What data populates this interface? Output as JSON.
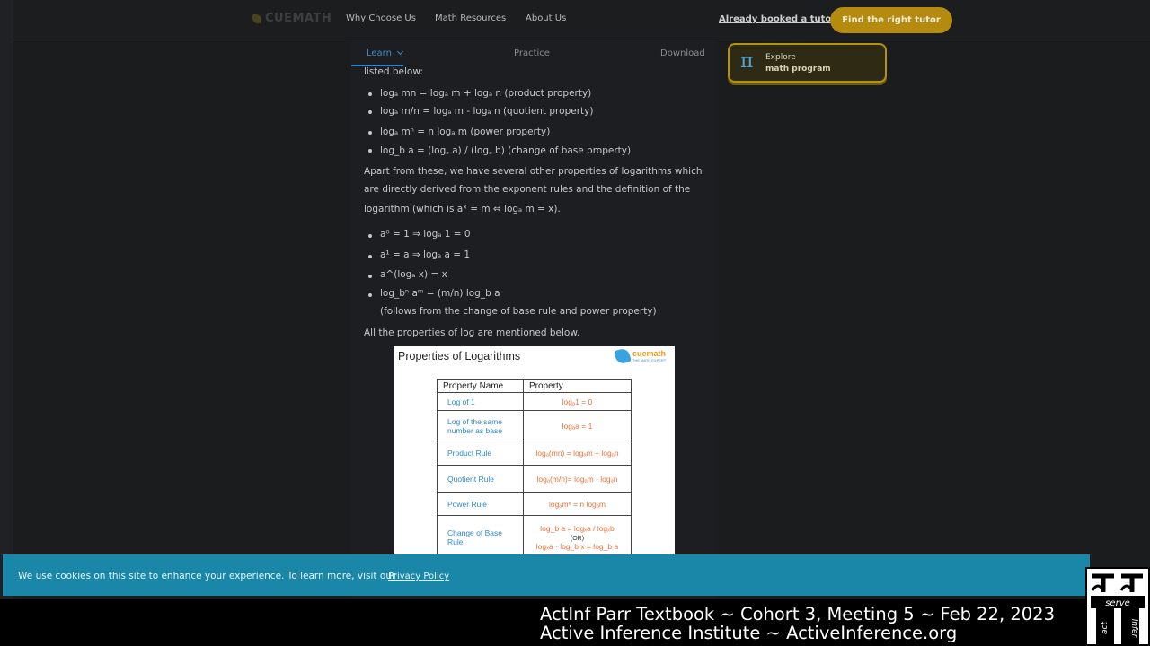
{
  "nav": {
    "logo": "CUEMATH",
    "links": [
      "Why Choose Us",
      "Math Resources",
      "About Us"
    ],
    "already_booked": "Already booked a tutor?",
    "find_tutor": "Find the right tutor"
  },
  "subnav": {
    "learn": "Learn",
    "practice": "Practice",
    "download": "Download"
  },
  "article": {
    "listed_below": "listed below:",
    "bullets1": [
      "logₐ mn = logₐ m + logₐ n (product property)",
      "logₐ m/n = logₐ m - logₐ n (quotient property)",
      "logₐ mⁿ = n logₐ m (power property)",
      "log_b a = (log꜀ a) / (log꜀ b) (change of base property)"
    ],
    "para_lines": [
      "Apart from these, we have several other properties of logarithms which",
      "are directly derived from the exponent rules and the definition of the",
      "logarithm (which is aˣ = m ⇔ logₐ m = x)."
    ],
    "bullets2": [
      "a⁰ = 1 ⇒ logₐ 1 = 0",
      "a¹ = a ⇒ logₐ a = 1",
      "a^(logₐ x) = x",
      "log_bⁿ aᵐ = (m/n) log_b a"
    ],
    "follows_note": "(follows from the change of base rule and power property)",
    "all_props": "All the properties of log are mentioned below."
  },
  "card": {
    "title": "Properties of Logarithms",
    "brand_name": "cuemath",
    "brand_tag": "THE MATH EXPERT",
    "headers": [
      "Property Name",
      "Property"
    ],
    "rows": [
      {
        "name": "Log of 1",
        "value": "logₐ1 = 0"
      },
      {
        "name": "Log of the same number as base",
        "value": "logₐa = 1"
      },
      {
        "name": "Product Rule",
        "value": "logₐ(mn) = logₐm + logₐn"
      },
      {
        "name": "Quotient Rule",
        "value": "logₐ(m/n)= logₐm - logₐn"
      },
      {
        "name": "Power Rule",
        "value": "logₐmⁿ = n logₐm"
      },
      {
        "name": "Change of Base Rule",
        "value": "log_b a = logₓa / logₓb"
      }
    ],
    "or_label": "(OR)",
    "last_line": "logₓa · log_b x = log_b a"
  },
  "explore": {
    "icon": "pi-icon",
    "title": "Explore",
    "subtitle": "math program"
  },
  "cookie": {
    "message": "We use cookies on this site to enhance your experience. To learn more, visit our",
    "link": "Privacy Policy"
  },
  "caption": {
    "line1": "ActInf Parr Textbook ~ Cohort 3, Meeting 5 ~ Feb 22, 2023",
    "line2": "Active Inference Institute ~ ActiveInference.org"
  },
  "institute_logo": {
    "words": [
      "act",
      "serve",
      "infer"
    ]
  },
  "colors": {
    "background": "#1b1c1e",
    "accent_yellow": "#b58b0f",
    "link_blue": "#3b8ccc",
    "cookie_bar": "#1a87a8",
    "table_name_blue": "#2c88c8",
    "table_value_orange": "#e8733b"
  }
}
